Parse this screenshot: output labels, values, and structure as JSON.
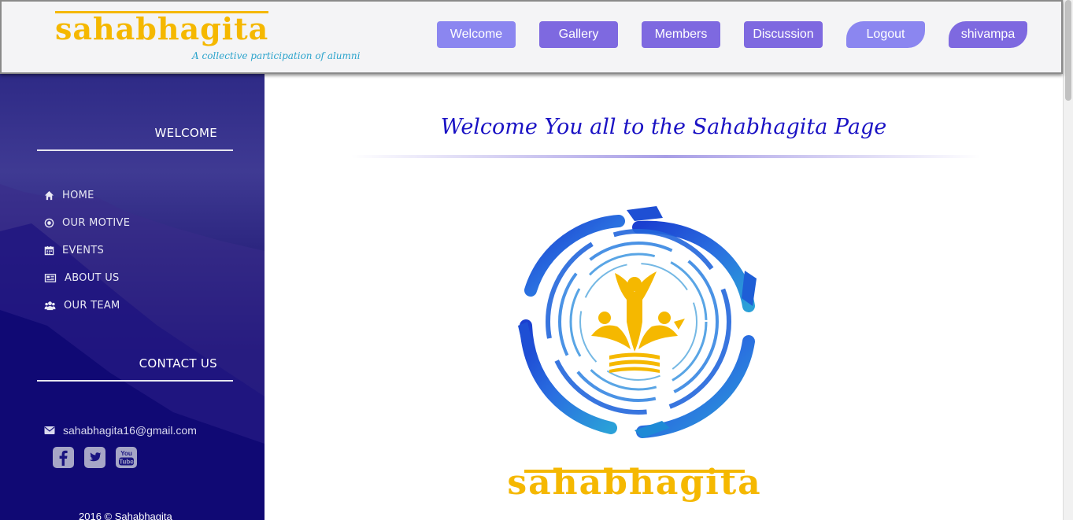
{
  "header": {
    "logo_text": "sahabhagita",
    "tagline": "A collective participation of alumni",
    "nav": {
      "welcome": "Welcome",
      "gallery": "Gallery",
      "members": "Members",
      "discussion": "Discussion",
      "logout": "Logout",
      "user": "shivampa"
    }
  },
  "sidebar": {
    "welcome_title": "WELCOME",
    "menu": {
      "home": "HOME",
      "motive": "OUR MOTIVE",
      "events": "EVENTS",
      "about": "ABOUT US",
      "team": "OUR TEAM"
    },
    "contact_title": "CONTACT US",
    "email": "sahabhagita16@gmail.com",
    "social_icons": [
      "facebook-icon",
      "twitter-icon",
      "youtube-icon"
    ],
    "copyright": "2016 © Sahabhagita"
  },
  "main": {
    "heading": "Welcome You all to the Sahabhagita Page",
    "brand_word": "sahabhagita"
  },
  "colors": {
    "nav_button": "#7e69e0",
    "nav_button_light": "#8b86f0",
    "sidebar_dark": "#0a0570",
    "heading": "#1a12c4",
    "brand_gold": "#f5b800",
    "emblem_blue": "#1e5ed6"
  }
}
